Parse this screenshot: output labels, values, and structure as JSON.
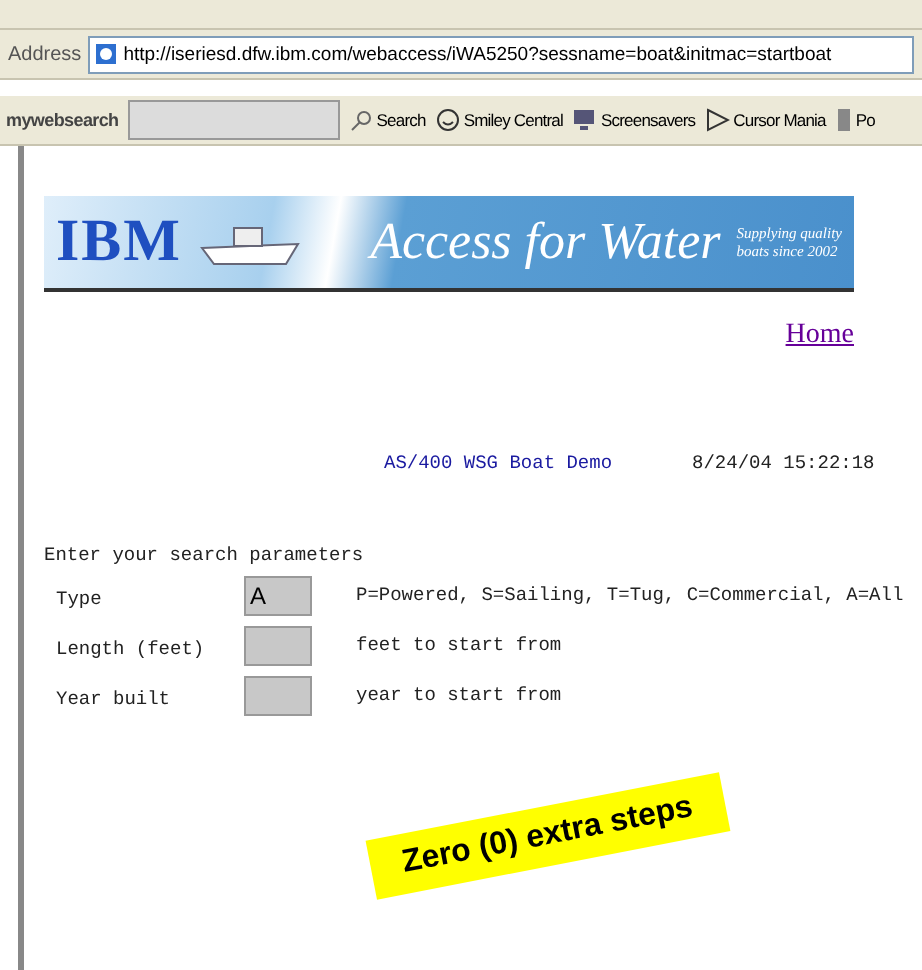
{
  "address_bar": {
    "label": "Address",
    "url": "http://iseriesd.dfw.ibm.com/webaccess/iWA5250?sessname=boat&initmac=startboat"
  },
  "search_toolbar": {
    "logo": "my**web**search",
    "search_button": "Search",
    "links": [
      {
        "label": "Smiley Central"
      },
      {
        "label": "Screensavers"
      },
      {
        "label": "Cursor Mania"
      },
      {
        "label": "Po"
      }
    ]
  },
  "banner": {
    "logo": "IBM",
    "title": "Access for Water",
    "tagline": [
      "Supplying quality",
      "boats since 2002"
    ]
  },
  "home_link": "Home",
  "screen": {
    "title": "AS/400 WSG Boat Demo",
    "timestamp": "8/24/04 15:22:18",
    "prompt": "Enter your search parameters",
    "fields": [
      {
        "label": "Type",
        "value": "A",
        "hint": "P=Powered, S=Sailing, T=Tug, C=Commercial, A=All"
      },
      {
        "label": "Length (feet)",
        "hint": "feet to start from"
      },
      {
        "label": "Year built",
        "hint": "year to start from"
      }
    ]
  },
  "callout": "Zero (0) extra steps"
}
